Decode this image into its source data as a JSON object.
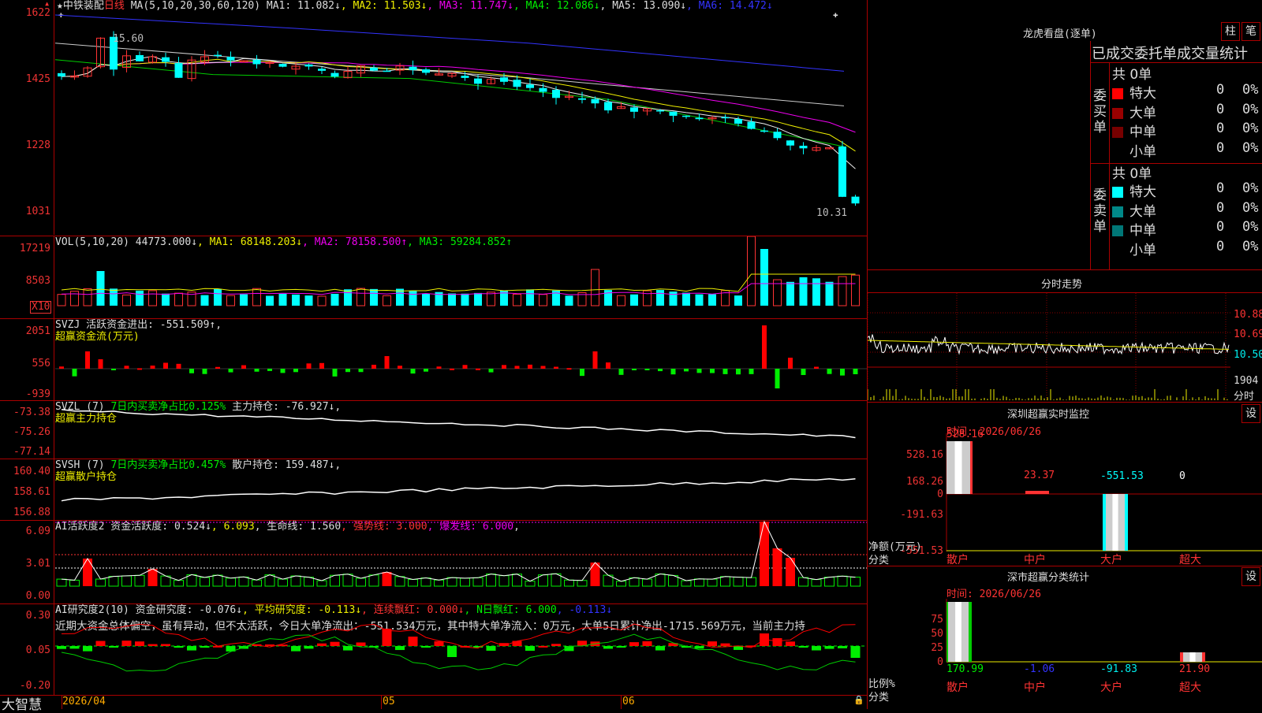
{
  "stock": {
    "star": "★",
    "name": "中铁装配",
    "period": "日线"
  },
  "price_axis": [
    "1622",
    "1425",
    "1228",
    "1031"
  ],
  "price_markers": {
    "high": "15.60",
    "low": "10.31"
  },
  "ma_header": [
    {
      "text": "MA(5,10,20,30,60,120)",
      "color": "wh"
    },
    {
      "text": " MA1: 11.082↓",
      "color": "wh"
    },
    {
      "text": ", MA2: 11.503↓",
      "color": "ye"
    },
    {
      "text": ", MA3: 11.747↓",
      "color": "mg"
    },
    {
      "text": ", MA4: 12.086↓",
      "color": "gr"
    },
    {
      "text": ", MA5: 13.090↓",
      "color": "wh"
    },
    {
      "text": ", MA6: 14.472↓",
      "color": "bl"
    }
  ],
  "vol": {
    "axis": [
      "17219",
      "8503"
    ],
    "unit": "X10",
    "header": [
      {
        "text": "VOL(5,10,20) ",
        "color": "wh"
      },
      {
        "text": "44773.000↓",
        "color": "wh"
      },
      {
        "text": ", MA1: 68148.203↓",
        "color": "ye"
      },
      {
        "text": ", MA2: 78158.500↑",
        "color": "mg"
      },
      {
        "text": ", MA3: 59284.852↑",
        "color": "gr"
      }
    ]
  },
  "svzj": {
    "axis": [
      "2051",
      "556",
      "-939"
    ],
    "line1": [
      {
        "text": "SVZJ  活跃资金进出: -551.509↑",
        "color": "wh"
      },
      {
        "text": ",",
        "color": "wh"
      }
    ],
    "line2": "超赢资金流(万元)"
  },
  "svzl": {
    "axis": [
      "-73.38",
      "-75.26",
      "-77.14"
    ],
    "line1": [
      {
        "text": "SVZL (7) ",
        "color": "wh"
      },
      {
        "text": "7日内买卖净占比0.125%",
        "color": "gr"
      },
      {
        "text": " 主力持仓: -76.927↓,",
        "color": "wh"
      }
    ],
    "line2": "超赢主力持仓"
  },
  "svsh": {
    "axis": [
      "160.40",
      "158.61",
      "156.88"
    ],
    "line1": [
      {
        "text": "SVSH (7) ",
        "color": "wh"
      },
      {
        "text": "7日内买卖净占比0.457%",
        "color": "gr"
      },
      {
        "text": " 散户持仓: 159.487↓,",
        "color": "wh"
      }
    ],
    "line2": "超赢散户持仓"
  },
  "ai_act": {
    "axis": [
      "6.09",
      "3.01",
      "0.00"
    ],
    "line1": [
      {
        "text": "AI活跃度2 资金活跃度: 0.524↓",
        "color": "wh"
      },
      {
        "text": ", 6.093",
        "color": "ye"
      },
      {
        "text": ", 生命线: 1.560",
        "color": "wh"
      },
      {
        "text": ", 强势线: 3.000",
        "color": "rd"
      },
      {
        "text": ", 爆发线: 6.000",
        "color": "mg"
      },
      {
        "text": ",",
        "color": "wh"
      }
    ]
  },
  "ai_res": {
    "axis": [
      "0.30",
      "0.05",
      "-0.20"
    ],
    "line1": [
      {
        "text": "AI研究度2(10) 资金研究度: -0.076↓",
        "color": "wh"
      },
      {
        "text": ", 平均研究度: -0.113↓",
        "color": "ye"
      },
      {
        "text": ", 连续飘红: 0.000↓",
        "color": "rd"
      },
      {
        "text": ", N日飘红: 6.000",
        "color": "gr"
      },
      {
        "text": ", -0.113↓",
        "color": "bl"
      }
    ],
    "line2": "近期大资金总体偏空，虽有异动，但不太活跃，今日大单净流出：-551.534万元，其中特大单净流入：0万元，大单5日累计净出-1715.569万元，当前主力持"
  },
  "bottom": {
    "logo": "大智慧",
    "dates": [
      "2026/04",
      "05",
      "06"
    ]
  },
  "lhb": {
    "title": "龙虎看盘(逐单)",
    "btn_zhu": "柱",
    "btn_bi": "笔",
    "subtitle": "已成交委托单成交量统计",
    "buy_label": "委买单",
    "sell_label": "委卖单",
    "total_buy": "共 0单",
    "total_sell": "共 0单",
    "buy_rows": [
      {
        "name": "特大",
        "n": "0",
        "p": "0%",
        "color": "#f00"
      },
      {
        "name": "大单",
        "n": "0",
        "p": "0%",
        "color": "#900"
      },
      {
        "name": "中单",
        "n": "0",
        "p": "0%",
        "color": "#700"
      },
      {
        "name": "小单",
        "n": "0",
        "p": "0%",
        "color": ""
      }
    ],
    "sell_rows": [
      {
        "name": "特大",
        "n": "0",
        "p": "0%",
        "color": "#0ff"
      },
      {
        "name": "大单",
        "n": "0",
        "p": "0%",
        "color": "#088"
      },
      {
        "name": "中单",
        "n": "0",
        "p": "0%",
        "color": "#077"
      },
      {
        "name": "小单",
        "n": "0",
        "p": "0%",
        "color": ""
      }
    ]
  },
  "fenshi": {
    "title": "分时走势",
    "axis": [
      "10.88",
      "10.69",
      "10.50"
    ],
    "vol": "1904",
    "unit": "分时"
  },
  "sz_monitor": {
    "title": "深圳超赢实时监控",
    "btn": "设",
    "time": "时间: 2026/06/26",
    "axis": [
      "528.16",
      "168.26",
      "0",
      "-191.63",
      "-551.53"
    ],
    "values": [
      "528.16",
      "23.37",
      "-551.53",
      "0"
    ],
    "ylabel": "净额(万元)",
    "xlabel": "分类",
    "cats": [
      "散户",
      "中户",
      "大户",
      "超大"
    ]
  },
  "sz_class": {
    "title": "深市超赢分类统计",
    "btn": "设",
    "time": "时间: 2026/06/26",
    "axis": [
      "75",
      "50",
      "25",
      "0"
    ],
    "values": [
      "170.99",
      "-1.06",
      "-91.83",
      "21.90"
    ],
    "ylabel": "比例%",
    "xlabel": "分类",
    "cats": [
      "散户",
      "中户",
      "大户",
      "超大"
    ]
  }
}
